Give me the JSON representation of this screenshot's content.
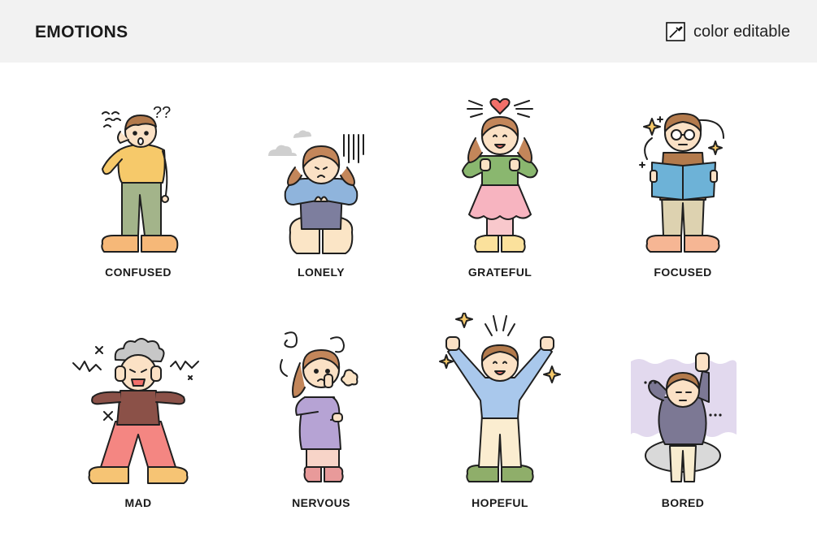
{
  "header": {
    "title": "EMOTIONS",
    "badge_text": "color editable",
    "badge_icon": "eyedropper-icon"
  },
  "emotions": [
    {
      "label": "CONFUSED",
      "colors": {
        "top": "#f6c96a",
        "bottom": "#a3b48a",
        "shoes": "#f6b878",
        "hair": "#b37a4c"
      }
    },
    {
      "label": "LONELY",
      "colors": {
        "top": "#8fb4dc",
        "bottom": "#7d7e9e",
        "shoes": "#fbe5c6",
        "hair": "#c3865a"
      }
    },
    {
      "label": "GRATEFUL",
      "colors": {
        "top": "#8ab76f",
        "bottom": "#f7b4c0",
        "shoes": "#fbe19c",
        "hair": "#c3865a"
      }
    },
    {
      "label": "FOCUSED",
      "colors": {
        "top": "#6db2d7",
        "bottom": "#ddd2b0",
        "shoes": "#f6b694",
        "hair": "#b37a4c"
      }
    },
    {
      "label": "MAD",
      "colors": {
        "top": "#8b5148",
        "bottom": "#f48682",
        "shoes": "#f6c474",
        "hair": "#c7c7c7"
      }
    },
    {
      "label": "NERVOUS",
      "colors": {
        "top": "#b6a3d4",
        "bottom": "#f7d4c8",
        "shoes": "#e89a9a",
        "hair": "#c3865a"
      }
    },
    {
      "label": "HOPEFUL",
      "colors": {
        "top": "#a9c8ec",
        "bottom": "#fbedd0",
        "shoes": "#8fae6a",
        "hair": "#b37a4c"
      }
    },
    {
      "label": "BORED",
      "colors": {
        "top": "#7c7894",
        "bottom": "#f8eccf",
        "shoes": "#d9d9d9",
        "hair": "#b37a4c"
      }
    }
  ]
}
